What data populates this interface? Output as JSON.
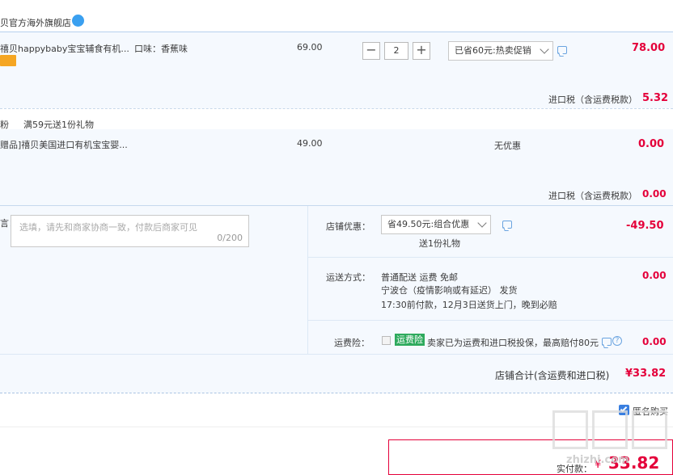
{
  "shop": {
    "name": "贝官方海外旗舰店"
  },
  "item1": {
    "title": "禧贝happybaby宝宝辅食有机...",
    "flavor": "口味：香蕉味",
    "price": "69.00",
    "quantity": "2",
    "promo": "已省60元:热卖促销",
    "total": "78.00",
    "tax_label": "进口税（含运费税款）",
    "tax_value": "5.32"
  },
  "gift_promo": {
    "tag": "粉",
    "text": "满59元送1份礼物"
  },
  "item2": {
    "title": "赠品]禧贝美国进口有机宝宝婴...",
    "price": "49.00",
    "promo": "无优惠",
    "total": "0.00",
    "tax_label": "进口税（含运费税款）",
    "tax_value": "0.00"
  },
  "message": {
    "label": "言：",
    "placeholder": "选填，请先和商家协商一致，付款后商家可见",
    "counter": "0/200"
  },
  "shop_discount": {
    "label": "店铺优惠：",
    "select": "省49.50元:组合优惠",
    "gift": "送1份礼物",
    "value": "-49.50"
  },
  "shipping": {
    "label": "运送方式：",
    "line1": "普通配送 运费 免邮",
    "line2": "宁波仓（疫情影响或有延迟）  发货",
    "line3": "17:30前付款，12月3日送货上门，晚到必赔",
    "value": "0.00"
  },
  "insurance": {
    "label": "运费险：",
    "badge": "运费险",
    "text": "卖家已为运费和进口税投保，最高赔付80元",
    "value": "0.00"
  },
  "shop_total": {
    "label": "店铺合计(含运费和进口税)",
    "value": "¥33.82"
  },
  "anonymous": {
    "label": "匿名购买"
  },
  "payment": {
    "label": "实付款：",
    "currency": "¥",
    "value": "33.82"
  },
  "watermark": "zhizhi.com",
  "colors": {
    "price_red": "#e4003a",
    "block_bg": "#f5f9fe",
    "insurance_green": "#2eaa5d",
    "checkbox_blue": "#3a7fe0"
  }
}
